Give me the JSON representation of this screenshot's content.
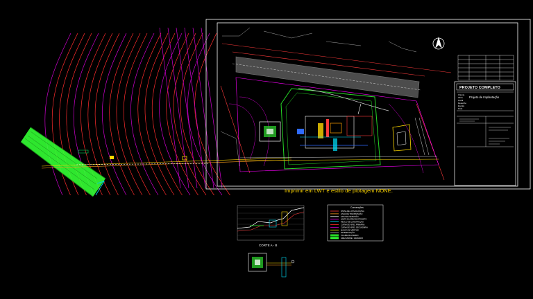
{
  "title_block": {
    "heading": "PROJETO COMPLETO",
    "subtitle": "Projeto de Implantação",
    "fields": [
      "Cliente",
      "Obra",
      "Local",
      "Desenho",
      "Escala",
      "Data"
    ]
  },
  "plotting_note": "Imprimir em LWT e  estilo de plotagem NONE.",
  "section_label": "CORTE A - B",
  "legend": {
    "title": "Convenções",
    "items": [
      {
        "label": "DIVISA DE LOTE DE DIVISA",
        "color": "#ff3b3b"
      },
      {
        "label": "LINHA DE TRANSMISSÃO",
        "color": "#ff9f1a"
      },
      {
        "label": "FAIXA DE SERVIDÃO",
        "color": "#ffffff"
      },
      {
        "label": "LIMITE DA ÁREA DE PROJETO",
        "color": "#ff00ff"
      },
      {
        "label": "RECUO DE CONSTRUÇÃO",
        "color": "#00e5ff"
      },
      {
        "label": "CURVA DE NÍVEL PRIMÁRIA",
        "color": "#ff2d2d"
      },
      {
        "label": "CURVA DE NÍVEL SECUNDÁRIA",
        "color": "#d000d0"
      },
      {
        "label": "MARCO DE VÉRTICE",
        "color": "#ffff00"
      },
      {
        "label": "PAVIMENTAÇÃO",
        "color": "#c8c8c8"
      },
      {
        "label": "TALUDE DE ATERRO",
        "color": "#26d926"
      },
      {
        "label": "ÁREA VERDE / GRAMADO",
        "color": "#33ff33"
      }
    ]
  },
  "colors": {
    "background": "#000000",
    "frame": "#ffffff",
    "contour_primary": "#ff2d2d",
    "contour_secondary": "#d000d0",
    "grass": "#33ff33",
    "road": "#c8c8c8",
    "water": "#2f6bff",
    "note": "#ffd700"
  }
}
